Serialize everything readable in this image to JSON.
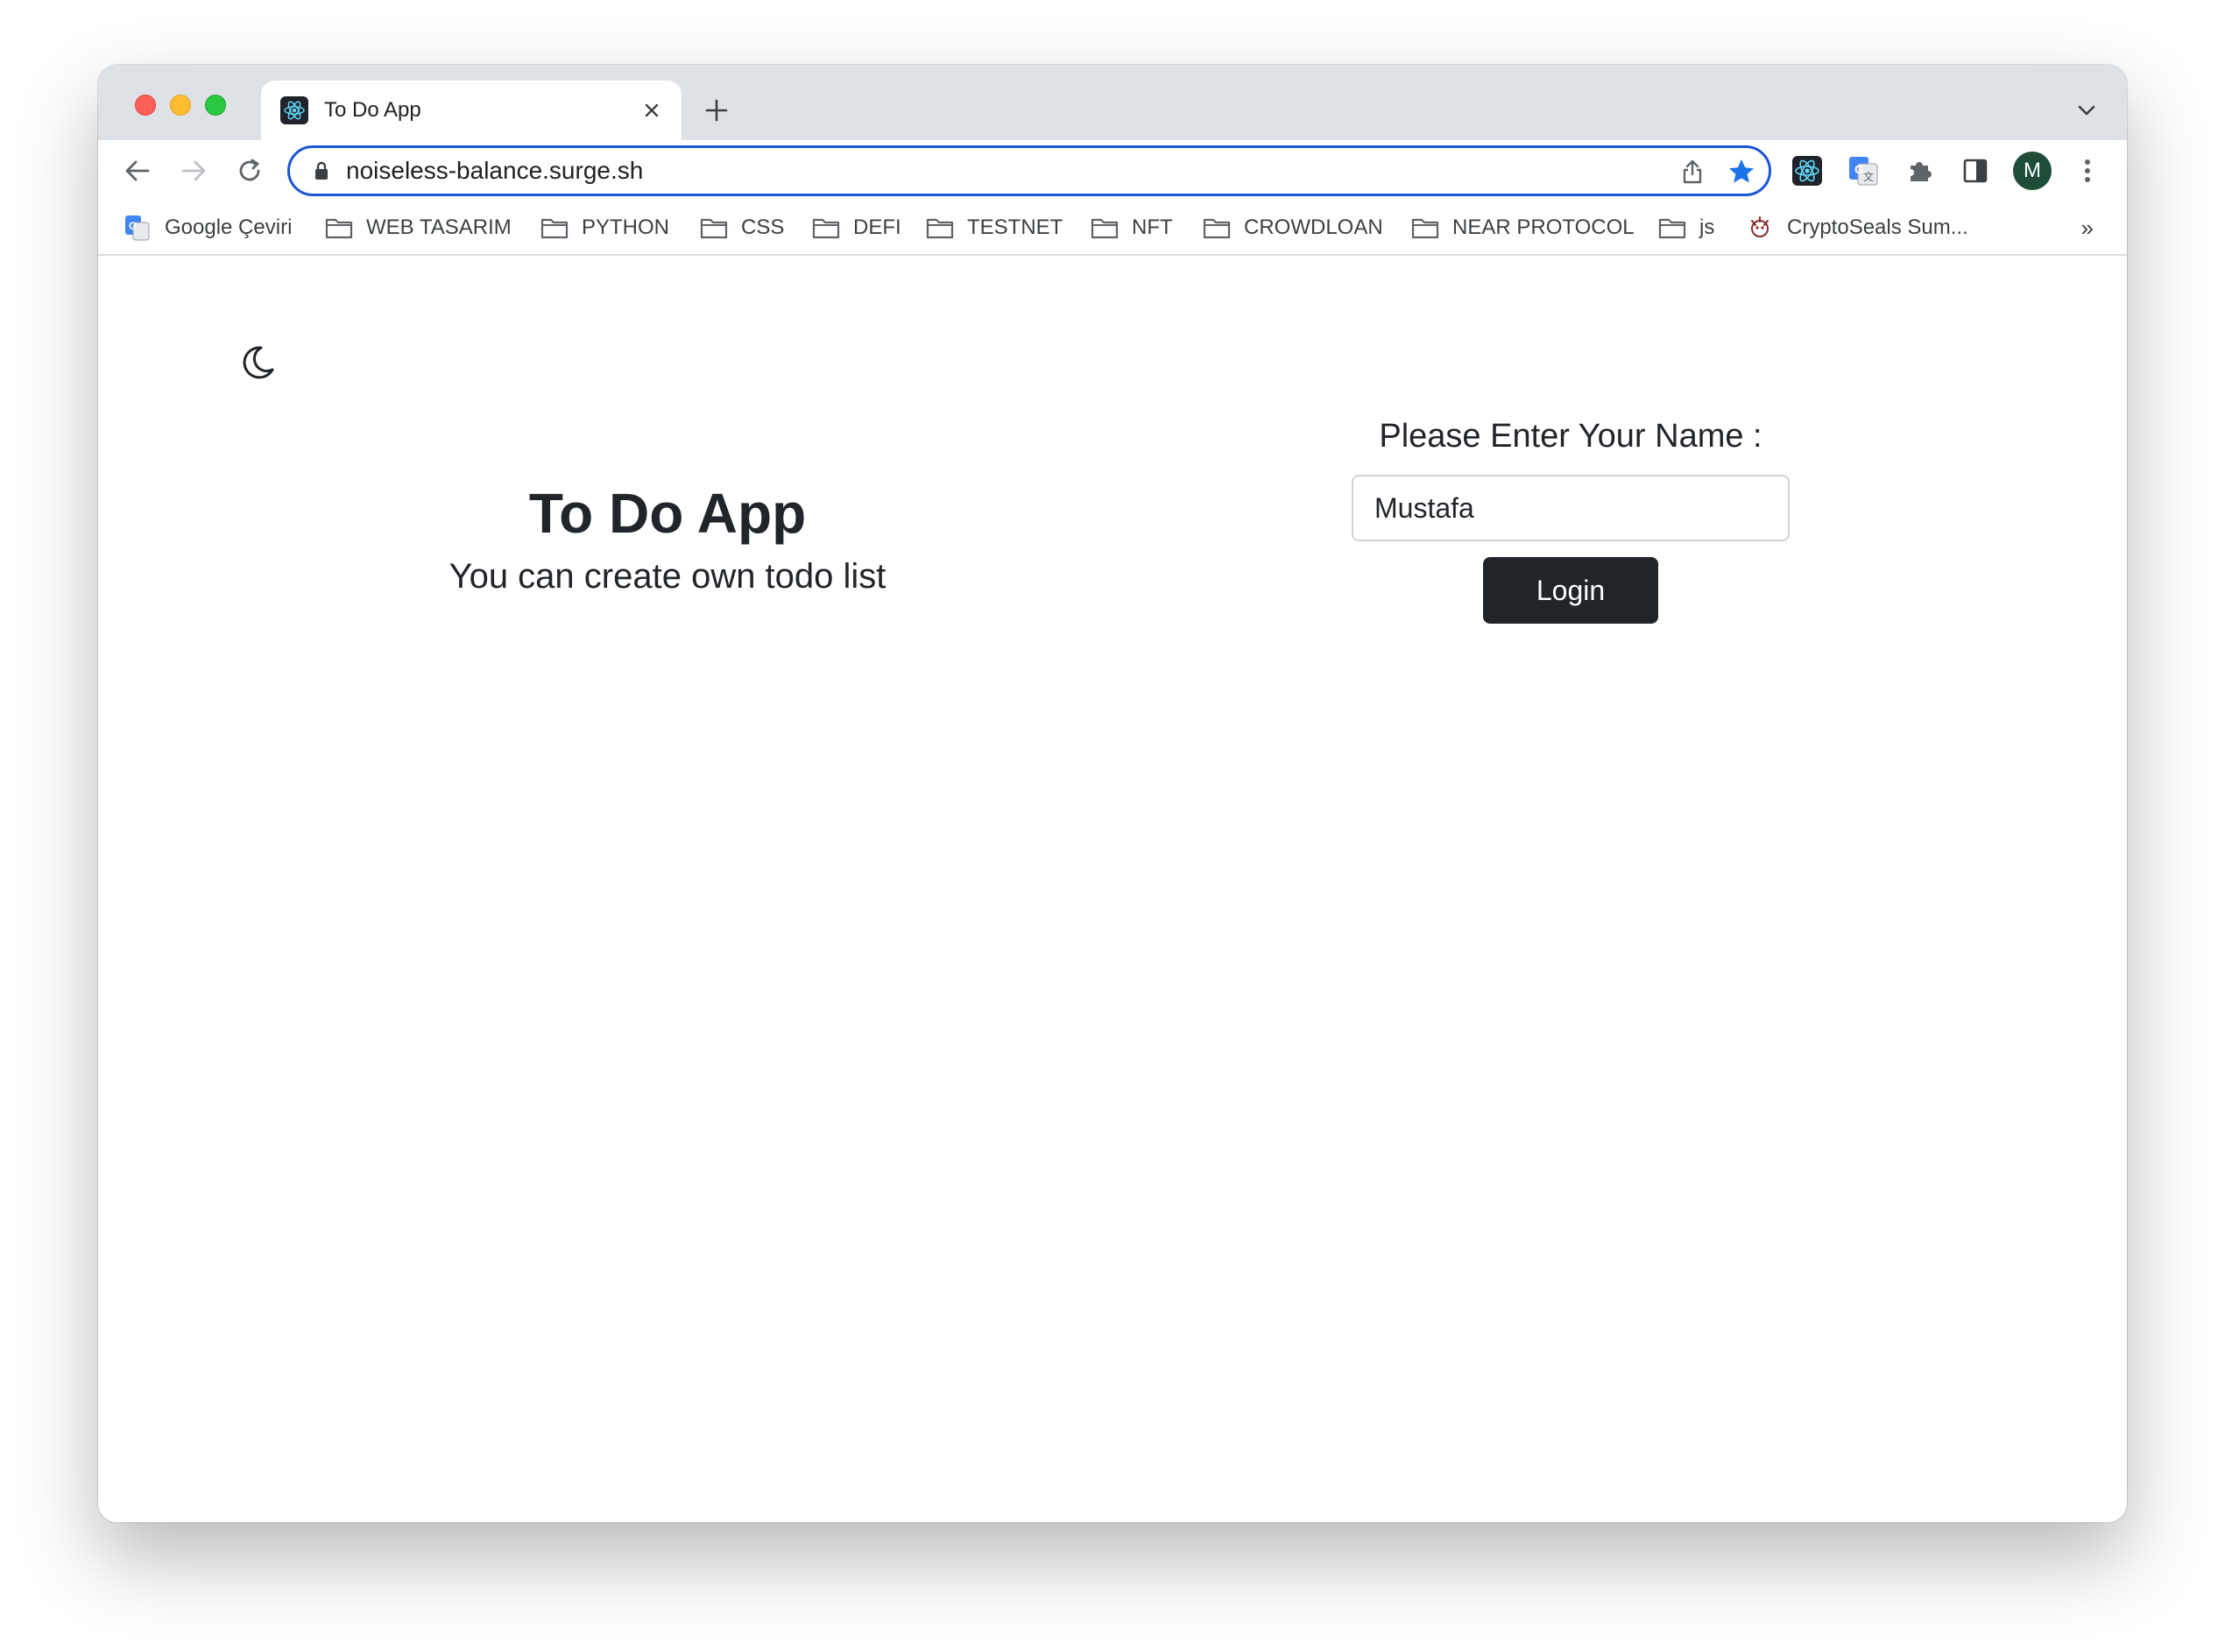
{
  "browser": {
    "tab": {
      "title": "To Do App",
      "favicon": "react-icon"
    },
    "url": "noiseless-balance.surge.sh",
    "profile_initial": "M",
    "colors": {
      "tabstrip": "#dee1e6",
      "omnibox_border": "#1a56d6",
      "star": "#1a73e8",
      "avatar": "#1e4d3a"
    }
  },
  "bookmarks": {
    "items": [
      {
        "label": "Google Çeviri",
        "icon": "google-translate-icon"
      },
      {
        "label": "WEB TASARIM",
        "icon": "folder-icon"
      },
      {
        "label": "PYTHON",
        "icon": "folder-icon"
      },
      {
        "label": "CSS",
        "icon": "folder-icon"
      },
      {
        "label": "DEFI",
        "icon": "folder-icon"
      },
      {
        "label": "TESTNET",
        "icon": "folder-icon"
      },
      {
        "label": "NFT",
        "icon": "folder-icon"
      },
      {
        "label": "CROWDLOAN",
        "icon": "folder-icon"
      },
      {
        "label": "NEAR PROTOCOL",
        "icon": "folder-icon"
      },
      {
        "label": "js",
        "icon": "folder-icon"
      },
      {
        "label": "CryptoSeals Sum...",
        "icon": "cryptoseals-icon"
      }
    ],
    "more": "»"
  },
  "page": {
    "title": "To Do App",
    "subtitle": "You can create own todo list",
    "login": {
      "prompt": "Please Enter Your Name :",
      "name_value": "Mustafa",
      "button_label": "Login"
    },
    "colors": {
      "text": "#212529",
      "button_bg": "#212529",
      "input_border": "#ced4da"
    }
  }
}
